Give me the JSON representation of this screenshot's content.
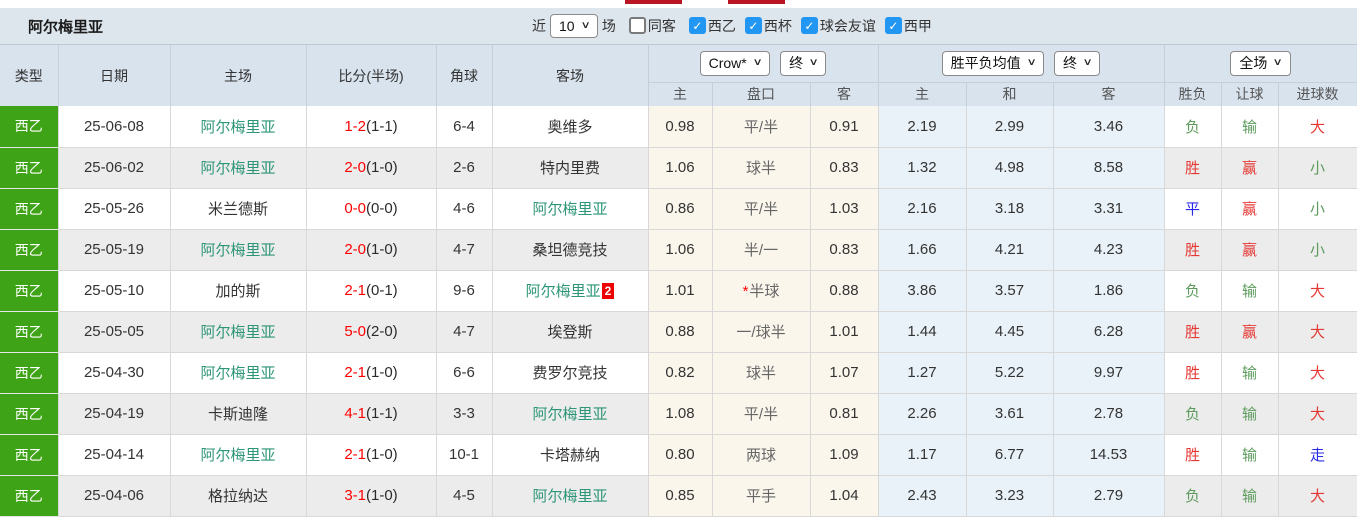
{
  "page": {
    "team_title": "阿尔梅里亚"
  },
  "filters": {
    "recent_label": "近",
    "recent_value": "10",
    "matches_label": "场",
    "checkboxes": [
      {
        "label": "同客",
        "checked": false
      },
      {
        "label": "西乙",
        "checked": true
      },
      {
        "label": "西杯",
        "checked": true
      },
      {
        "label": "球会友谊",
        "checked": true
      },
      {
        "label": "西甲",
        "checked": true
      }
    ]
  },
  "table": {
    "static_headers": [
      "类型",
      "日期",
      "主场",
      "比分(半场)",
      "角球",
      "客场"
    ],
    "group_controls": {
      "odds_source": "Crow*",
      "odds_time": "终",
      "avg_source": "胜平负均值",
      "avg_time": "终",
      "result_scope": "全场"
    },
    "sub_headers": [
      "主",
      "盘口",
      "客",
      "主",
      "和",
      "客",
      "胜负",
      "让球",
      "进球数"
    ],
    "rows": [
      {
        "league": "西乙",
        "date": "25-06-08",
        "home": "阿尔梅里亚",
        "home_red": null,
        "score": "1-2",
        "half": "(1-1)",
        "corners": "6-4",
        "away": "奥维多",
        "away_red": null,
        "crow": [
          "0.98",
          "平/半",
          "0.91"
        ],
        "star": false,
        "avg": [
          "2.19",
          "2.99",
          "3.46"
        ],
        "results": [
          "负",
          "输",
          "大"
        ]
      },
      {
        "league": "西乙",
        "date": "25-06-02",
        "home": "阿尔梅里亚",
        "home_red": null,
        "score": "2-0",
        "half": "(1-0)",
        "corners": "2-6",
        "away": "特内里费",
        "away_red": null,
        "crow": [
          "1.06",
          "球半",
          "0.83"
        ],
        "star": false,
        "avg": [
          "1.32",
          "4.98",
          "8.58"
        ],
        "results": [
          "胜",
          "赢",
          "小"
        ]
      },
      {
        "league": "西乙",
        "date": "25-05-26",
        "home": "米兰德斯",
        "home_red": null,
        "score": "0-0",
        "half": "(0-0)",
        "corners": "4-6",
        "away": "阿尔梅里亚",
        "away_red": null,
        "crow": [
          "0.86",
          "平/半",
          "1.03"
        ],
        "star": false,
        "avg": [
          "2.16",
          "3.18",
          "3.31"
        ],
        "results": [
          "平",
          "赢",
          "小"
        ]
      },
      {
        "league": "西乙",
        "date": "25-05-19",
        "home": "阿尔梅里亚",
        "home_red": null,
        "score": "2-0",
        "half": "(1-0)",
        "corners": "4-7",
        "away": "桑坦德竞技",
        "away_red": null,
        "crow": [
          "1.06",
          "半/一",
          "0.83"
        ],
        "star": false,
        "avg": [
          "1.66",
          "4.21",
          "4.23"
        ],
        "results": [
          "胜",
          "赢",
          "小"
        ]
      },
      {
        "league": "西乙",
        "date": "25-05-10",
        "home": "加的斯",
        "home_red": null,
        "score": "2-1",
        "half": "(0-1)",
        "corners": "9-6",
        "away": "阿尔梅里亚",
        "away_red": "2",
        "crow": [
          "1.01",
          "半球",
          "0.88"
        ],
        "star": true,
        "avg": [
          "3.86",
          "3.57",
          "1.86"
        ],
        "results": [
          "负",
          "输",
          "大"
        ]
      },
      {
        "league": "西乙",
        "date": "25-05-05",
        "home": "阿尔梅里亚",
        "home_red": null,
        "score": "5-0",
        "half": "(2-0)",
        "corners": "4-7",
        "away": "埃登斯",
        "away_red": null,
        "crow": [
          "0.88",
          "一/球半",
          "1.01"
        ],
        "star": false,
        "avg": [
          "1.44",
          "4.45",
          "6.28"
        ],
        "results": [
          "胜",
          "赢",
          "大"
        ]
      },
      {
        "league": "西乙",
        "date": "25-04-30",
        "home": "阿尔梅里亚",
        "home_red": null,
        "score": "2-1",
        "half": "(1-0)",
        "corners": "6-6",
        "away": "费罗尔竞技",
        "away_red": null,
        "crow": [
          "0.82",
          "球半",
          "1.07"
        ],
        "star": false,
        "avg": [
          "1.27",
          "5.22",
          "9.97"
        ],
        "results": [
          "胜",
          "输",
          "大"
        ]
      },
      {
        "league": "西乙",
        "date": "25-04-19",
        "home": "卡斯迪隆",
        "home_red": null,
        "score": "4-1",
        "half": "(1-1)",
        "corners": "3-3",
        "away": "阿尔梅里亚",
        "away_red": null,
        "crow": [
          "1.08",
          "平/半",
          "0.81"
        ],
        "star": false,
        "avg": [
          "2.26",
          "3.61",
          "2.78"
        ],
        "results": [
          "负",
          "输",
          "大"
        ]
      },
      {
        "league": "西乙",
        "date": "25-04-14",
        "home": "阿尔梅里亚",
        "home_red": null,
        "score": "2-1",
        "half": "(1-0)",
        "corners": "10-1",
        "away": "卡塔赫纳",
        "away_red": null,
        "crow": [
          "0.80",
          "两球",
          "1.09"
        ],
        "star": false,
        "avg": [
          "1.17",
          "6.77",
          "14.53"
        ],
        "results": [
          "胜",
          "输",
          "走"
        ]
      },
      {
        "league": "西乙",
        "date": "25-04-06",
        "home": "格拉纳达",
        "home_red": null,
        "score": "3-1",
        "half": "(1-0)",
        "corners": "4-5",
        "away": "阿尔梅里亚",
        "away_red": null,
        "crow": [
          "0.85",
          "平手",
          "1.04"
        ],
        "star": false,
        "avg": [
          "2.43",
          "3.23",
          "2.79"
        ],
        "results": [
          "负",
          "输",
          "大"
        ]
      }
    ]
  },
  "colors": {
    "league_badge_green": "#3fa317",
    "team_link_green": "#2e9678",
    "score_red": "#ff0000",
    "result_red": "#e53935",
    "result_green": "#5d9b5d",
    "result_blue": "#2a2ae6",
    "checkbox_blue": "#2196f3",
    "crow_column_bg": "#faf6ec",
    "avg_column_bg": "#e9f2f8",
    "header_bg": "#d8e3ee",
    "filter_bar_bg": "#dde5ed",
    "top_tab_red": "#b91421",
    "red_card_badge": "#ee0000"
  }
}
